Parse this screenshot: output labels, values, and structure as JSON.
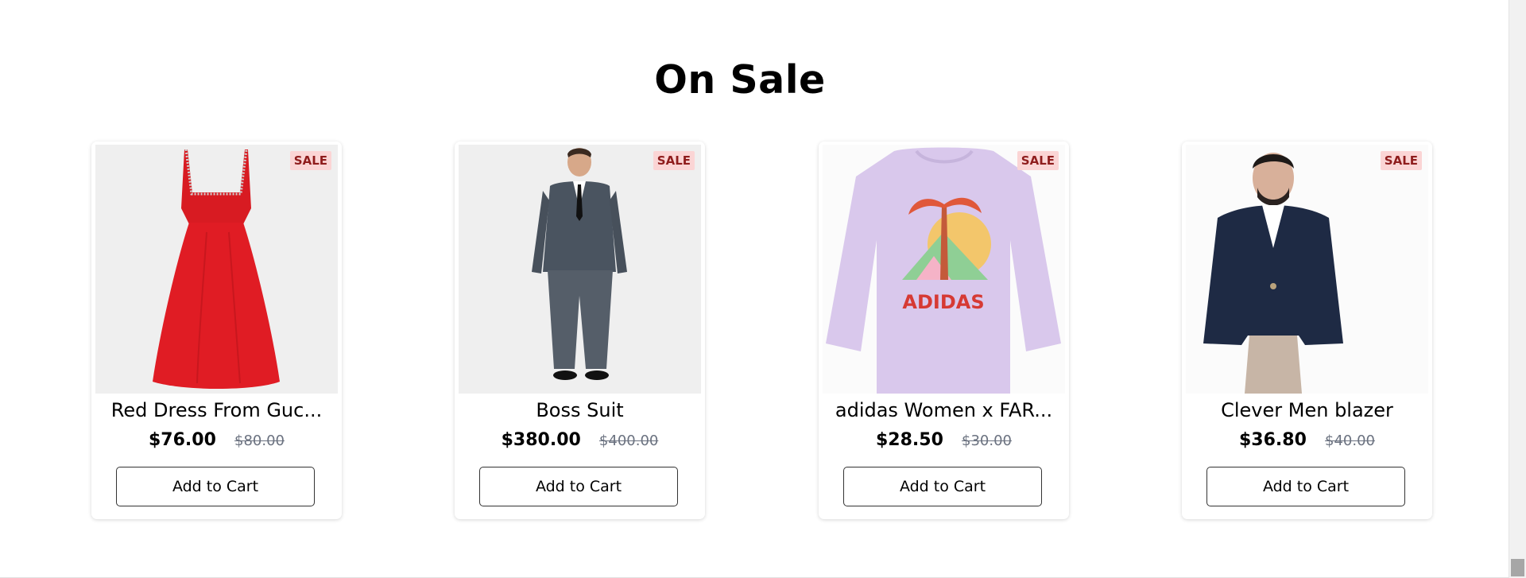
{
  "section": {
    "title": "On Sale"
  },
  "products": [
    {
      "name": "Red Dress From Guc...",
      "price": "$76.00",
      "old_price": "$80.00",
      "badge": "SALE",
      "button": "Add to Cart",
      "image": "red-dress-image"
    },
    {
      "name": "Boss Suit",
      "price": "$380.00",
      "old_price": "$400.00",
      "badge": "SALE",
      "button": "Add to Cart",
      "image": "suit-image"
    },
    {
      "name": "adidas Women x FAR...",
      "price": "$28.50",
      "old_price": "$30.00",
      "badge": "SALE",
      "button": "Add to Cart",
      "image": "tshirt-image",
      "image_text": "ADIDAS"
    },
    {
      "name": "Clever Men blazer",
      "price": "$36.80",
      "old_price": "$40.00",
      "badge": "SALE",
      "button": "Add to Cart",
      "image": "blazer-image"
    }
  ],
  "colors": {
    "badge_bg": "#fbd5d5",
    "badge_text": "#8f1d1d",
    "dress": "#e01c24",
    "shirt": "#d9c8ec"
  }
}
